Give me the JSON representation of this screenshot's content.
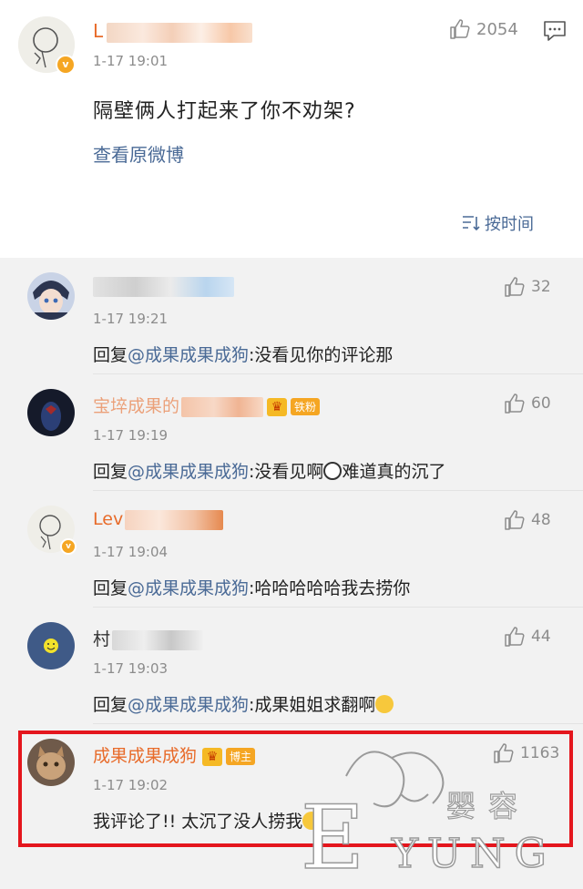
{
  "post": {
    "author_visible": "L",
    "time": "1-17 19:01",
    "likes": "2054",
    "text": "隔壁俩人打起来了你不劝架?",
    "view_original": "查看原微博",
    "sort_label": "按时间"
  },
  "replies": [
    {
      "name_visible": "",
      "time": "1-17 19:21",
      "likes": "32",
      "reply_prefix": "回复",
      "mention": "@成果成果成狗",
      "text": ":没看见你的评论那",
      "emoji": ""
    },
    {
      "name_visible": "宝埣成果的",
      "badge": "铁粉",
      "time": "1-17 19:19",
      "likes": "60",
      "reply_prefix": "回复",
      "mention": "@成果成果成狗",
      "text": ":没看见啊",
      "text_after_emoji": "难道真的沉了"
    },
    {
      "name_visible": "Lev",
      "time": "1-17 19:04",
      "likes": "48",
      "reply_prefix": "回复",
      "mention": "@成果成果成狗",
      "text": ":哈哈哈哈哈我去捞你"
    },
    {
      "name_visible": "村",
      "time": "1-17 19:03",
      "likes": "44",
      "reply_prefix": "回复",
      "mention": "@成果成果成狗",
      "text": ":成果姐姐求翻啊"
    },
    {
      "name_visible": "成果成果成狗",
      "badge": "博主",
      "time": "1-17 19:02",
      "likes": "1163",
      "text": "我评论了!! 太沉了没人捞我"
    }
  ],
  "watermark": {
    "letter": "E",
    "word": "YUNG",
    "cn": "婴容"
  },
  "colors": {
    "name_orange": "#e86b2a",
    "link_blue": "#4a6a96",
    "highlight_red": "#e4161d",
    "vip_badge": "#f5a623"
  },
  "icons": [
    "thumbs-up-icon",
    "comment-icon",
    "sort-icon",
    "verified-badge-icon",
    "crown-icon"
  ]
}
